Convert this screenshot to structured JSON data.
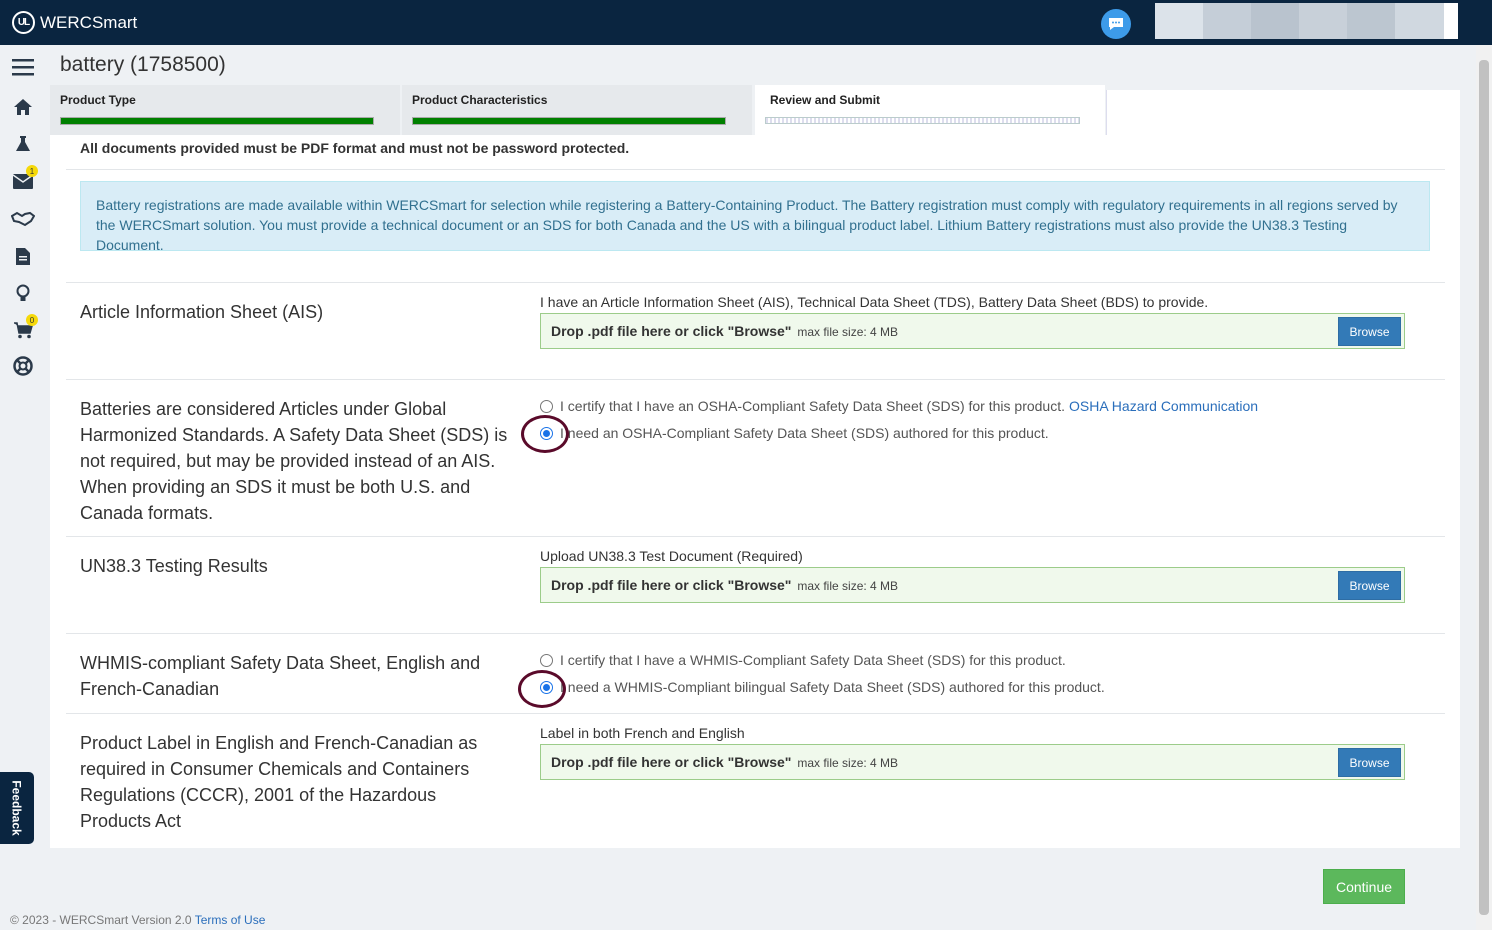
{
  "app": {
    "name": "WERCSmart",
    "logo_mark": "UL"
  },
  "header": {
    "chat_icon": "chat-bubble-icon"
  },
  "sidenav": {
    "items": [
      {
        "name": "menu-icon"
      },
      {
        "name": "home-icon"
      },
      {
        "name": "flask-icon"
      },
      {
        "name": "mail-icon",
        "badge": "1"
      },
      {
        "name": "handshake-icon"
      },
      {
        "name": "document-icon"
      },
      {
        "name": "lightbulb-icon"
      },
      {
        "name": "cart-icon",
        "badge": "0"
      },
      {
        "name": "lifebuoy-icon"
      }
    ]
  },
  "page": {
    "title": "battery (1758500)"
  },
  "tabs": [
    {
      "label": "Product Type",
      "state": "complete"
    },
    {
      "label": "Product Characteristics",
      "state": "complete"
    },
    {
      "label": "Review and Submit",
      "state": "active"
    }
  ],
  "notice": "All documents provided must be PDF format and must not be password protected.",
  "info": "Battery registrations are made available within WERCSmart for selection while registering a Battery-Containing Product. The Battery registration must comply with regulatory requirements in all regions served by the WERCSmart solution. You must provide a technical document or an SDS for both Canada and the US with a bilingual product label. Lithium Battery registrations must also provide the UN38.3 Testing Document.",
  "dropzone": {
    "text": "Drop .pdf file here or click \"Browse\"",
    "size": "max file size: 4 MB",
    "browse": "Browse"
  },
  "sections": {
    "ais": {
      "label": "Article Information Sheet (AIS)",
      "field_label": "I have an Article Information Sheet (AIS), Technical Data Sheet (TDS), Battery Data Sheet (BDS) to provide."
    },
    "sds": {
      "label": "Batteries are considered Articles under Global Harmonized Standards. A Safety Data Sheet (SDS) is not required, but may be provided instead of an AIS. When providing an SDS it must be both U.S. and Canada formats.",
      "option1": "I certify that I have an OSHA-Compliant Safety Data Sheet (SDS) for this product.",
      "option1_link": "OSHA Hazard Communication",
      "option2": "I need an OSHA-Compliant Safety Data Sheet (SDS) authored for this product.",
      "selected": 2
    },
    "un383": {
      "label": "UN38.3 Testing Results",
      "field_label": "Upload UN38.3 Test Document (Required)"
    },
    "whmis": {
      "label": "WHMIS-compliant Safety Data Sheet, English and French-Canadian",
      "option1": "I certify that I have a WHMIS-Compliant Safety Data Sheet (SDS) for this product.",
      "option2": "I need a WHMIS-Compliant bilingual Safety Data Sheet (SDS) authored for this product.",
      "selected": 2
    },
    "label": {
      "label": "Product Label in English and French-Canadian as required in Consumer Chemicals and Containers Regulations (CCCR), 2001 of the Hazardous Products Act",
      "field_label": "Label in both French and English"
    }
  },
  "actions": {
    "continue": "Continue"
  },
  "footer": {
    "text": "© 2023 - WERCSmart Version 2.0",
    "link": "Terms of Use"
  },
  "feedback": "Feedback"
}
